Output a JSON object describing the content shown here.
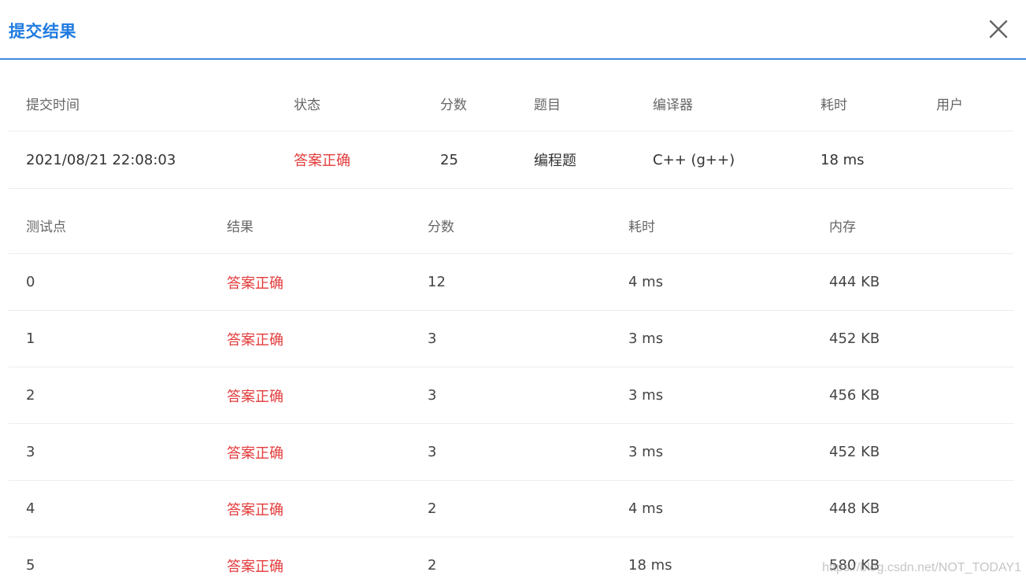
{
  "dialog": {
    "title": "提交结果",
    "close_icon": "close-icon"
  },
  "summary": {
    "headers": [
      "提交时间",
      "状态",
      "分数",
      "题目",
      "编译器",
      "耗时",
      "用户"
    ],
    "row": {
      "time": "2021/08/21 22:08:03",
      "status": "答案正确",
      "score": "25",
      "problem": "编程题",
      "compiler": "C++ (g++)",
      "duration": "18 ms",
      "user": ""
    }
  },
  "detail": {
    "headers": [
      "测试点",
      "结果",
      "分数",
      "耗时",
      "内存"
    ],
    "rows": [
      {
        "case": "0",
        "result": "答案正确",
        "score": "12",
        "time": "4 ms",
        "memory": "444 KB"
      },
      {
        "case": "1",
        "result": "答案正确",
        "score": "3",
        "time": "3 ms",
        "memory": "452 KB"
      },
      {
        "case": "2",
        "result": "答案正确",
        "score": "3",
        "time": "3 ms",
        "memory": "456 KB"
      },
      {
        "case": "3",
        "result": "答案正确",
        "score": "3",
        "time": "3 ms",
        "memory": "452 KB"
      },
      {
        "case": "4",
        "result": "答案正确",
        "score": "2",
        "time": "4 ms",
        "memory": "448 KB"
      },
      {
        "case": "5",
        "result": "答案正确",
        "score": "2",
        "time": "18 ms",
        "memory": "580 KB"
      }
    ]
  },
  "watermark": "https://blog.csdn.net/NOT_TODAY1",
  "colors": {
    "title": "#1f7be0",
    "accent_line": "#3f8ae0",
    "status_ok": "#e33b3b"
  }
}
